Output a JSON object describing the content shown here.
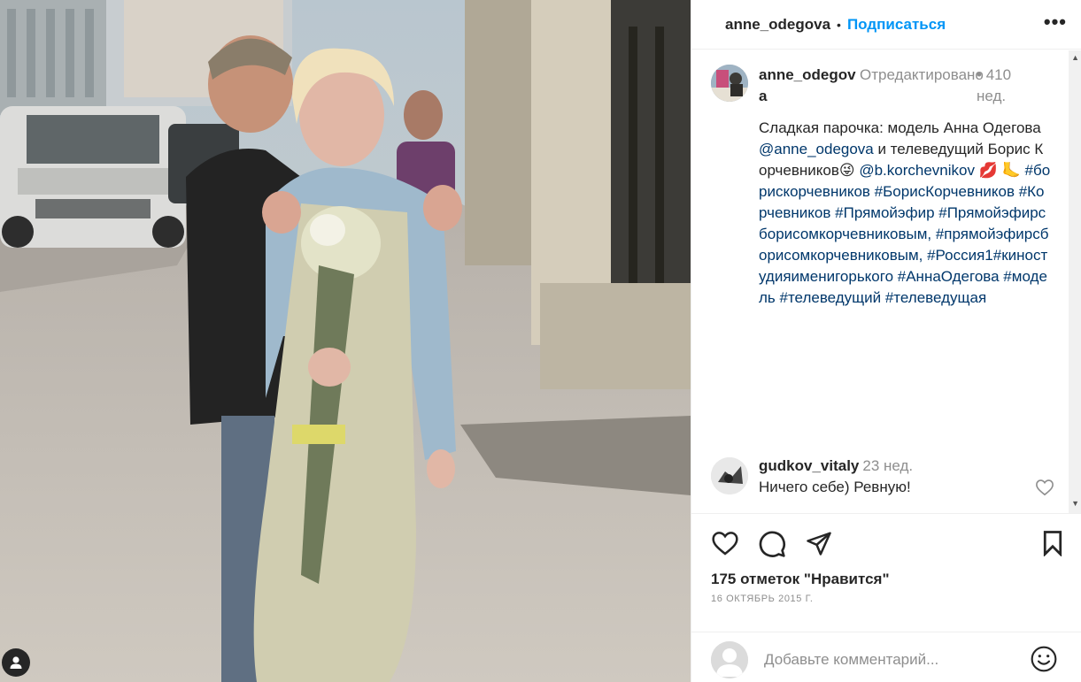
{
  "header": {
    "username": "anne_odegova",
    "separator": "•",
    "follow_label": "Подписаться",
    "more_label": "•••",
    "more_icon": "more-horizontal-icon"
  },
  "caption": {
    "username": "anne_odegova",
    "edited_label": "Отредактировано",
    "separator": "•",
    "time": "410 нед.",
    "text_intro": "Сладкая парочка: модель Анна Одегова ",
    "mention1": "@anne_odegova",
    "text_mid": " и телеведущий Борис Корчевников😜 ",
    "mention2": "@b.korchevnikov",
    "text_emoji": " 💋 🦶",
    "hashtags": "#борискорчевников #БорисКорчевников #Корчевников #Прямойэфир #Прямойэфирсборисомкорчевниковым, #прямойэфирсборисомкорчевниковым, #Россия1#киностудияименигорького #АннаОдегова #модель #телеведущий #телеведущая"
  },
  "comment": {
    "username": "gudkov_vitaly",
    "time": "23 нед.",
    "text": "Ничего себе) Ревную!"
  },
  "actions": {
    "like_icon": "heart-icon",
    "comment_icon": "comment-icon",
    "share_icon": "share-icon",
    "save_icon": "bookmark-icon"
  },
  "likes_text": "175 отметок \"Нравится\"",
  "date_text": "16 ОКТЯБРЬ 2015 Г.",
  "add_comment": {
    "placeholder": "Добавьте комментарий...",
    "emoji_icon": "emoji-icon"
  },
  "colors": {
    "accent": "#0095f6",
    "link": "#00376b",
    "muted": "#8e8e8e"
  }
}
